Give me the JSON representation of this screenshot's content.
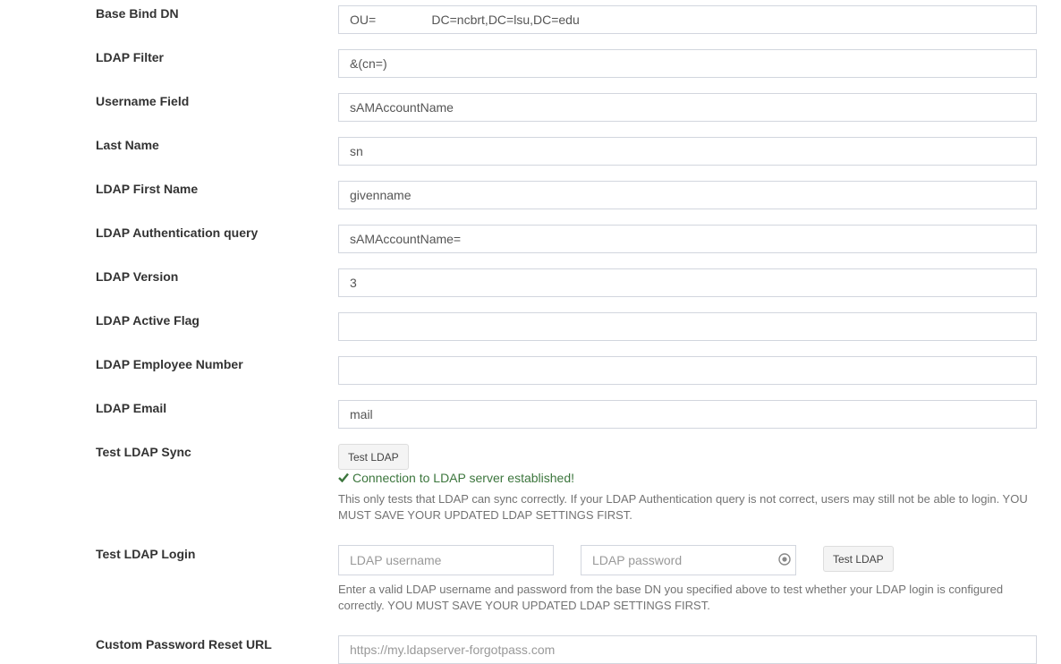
{
  "fields": [
    {
      "label": "Base Bind DN",
      "value": "OU=                DC=ncbrt,DC=lsu,DC=edu"
    },
    {
      "label": "LDAP Filter",
      "value": "&(cn=)"
    },
    {
      "label": "Username Field",
      "value": "sAMAccountName"
    },
    {
      "label": "Last Name",
      "value": "sn"
    },
    {
      "label": "LDAP First Name",
      "value": "givenname"
    },
    {
      "label": "LDAP Authentication query",
      "value": "sAMAccountName="
    },
    {
      "label": "LDAP Version",
      "value": "3"
    },
    {
      "label": "LDAP Active Flag",
      "value": ""
    },
    {
      "label": "LDAP Employee Number",
      "value": ""
    },
    {
      "label": "LDAP Email",
      "value": "mail"
    }
  ],
  "test_sync": {
    "label": "Test LDAP Sync",
    "button": "Test LDAP",
    "success": "Connection to LDAP server established!",
    "help": "This only tests that LDAP can sync correctly. If your LDAP Authentication query is not correct, users may still not be able to login. YOU MUST SAVE YOUR UPDATED LDAP SETTINGS FIRST."
  },
  "test_login": {
    "label": "Test LDAP Login",
    "username_placeholder": "LDAP username",
    "password_placeholder": "LDAP password",
    "button": "Test LDAP",
    "help": "Enter a valid LDAP username and password from the base DN you specified above to test whether your LDAP login is configured correctly. YOU MUST SAVE YOUR UPDATED LDAP SETTINGS FIRST."
  },
  "reset_url": {
    "label": "Custom Password Reset URL",
    "placeholder": "https://my.ldapserver-forgotpass.com"
  },
  "colors": {
    "success": "#3c763d",
    "border": "#d2d6de"
  }
}
